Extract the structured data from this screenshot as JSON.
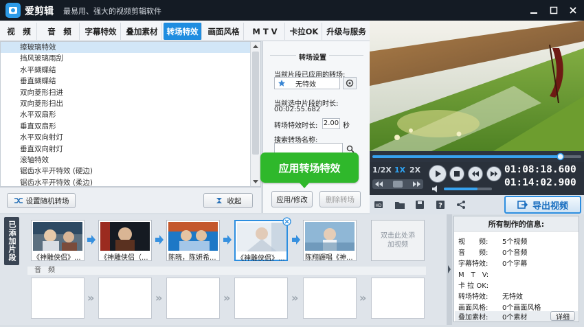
{
  "app": {
    "name": "爱剪辑",
    "slogan": "最易用、强大的视频剪辑软件"
  },
  "tabs": [
    "视　频",
    "音　频",
    "字幕特效",
    "叠加素材",
    "转场特效",
    "画面风格",
    "M T V",
    "卡拉OK",
    "升级与服务"
  ],
  "active_tab": "转场特效",
  "transitions": [
    "擦玻璃特效",
    "挡风玻璃雨刮",
    "水平蝴蝶结",
    "垂直蝴蝶结",
    "双向菱形扫进",
    "双向菱形扫出",
    "水平双扇形",
    "垂直双扇形",
    "水平双向射灯",
    "垂直双向射灯",
    "滚轴特效",
    "锯齿水平开特效 (硬边)",
    "锯齿水平开特效 (柔边)"
  ],
  "selected_transition": "擦玻璃特效",
  "left_bottom": {
    "random_button": "设置随机转场",
    "collapse_button": "收起"
  },
  "settings": {
    "section_title": "转场设置",
    "applied_label": "当前片段已应用的转场:",
    "applied_value": "无特效",
    "duration_label": "当前选中片段的时长:",
    "duration_value": "00:02:55.682",
    "effect_duration_label": "转场特效时长:",
    "effect_duration_value": "2.00",
    "effect_duration_unit": "秒",
    "search_label": "搜索转场名称:",
    "apply_button": "应用/修改",
    "delete_button": "删除转场"
  },
  "callout_text": "应用转场特效",
  "player": {
    "speed_half": "1/2X",
    "speed_1x": "1X",
    "speed_2x": "2X",
    "time_current": "01:08:18.600",
    "time_total": "01:14:02.900",
    "progress": 0.9,
    "volume": 0.7,
    "export_button": "导出视频"
  },
  "added_panel": {
    "label": "已添加片段",
    "clips": [
      "《神雕侠侣》...",
      "《神雕侠侣（...",
      "陈晓，陈妍希...",
      "《神雕侠侣》...",
      "陈翔鼲唱《神..."
    ],
    "add_hint": "双击此处添加视频",
    "audio_label": "音　频"
  },
  "info_panel": {
    "title": "所有制作的信息:",
    "rows": [
      {
        "key": "视　　频:",
        "value": "5个视频"
      },
      {
        "key": "音　　频:",
        "value": "0个音频"
      },
      {
        "key": "字幕特效:",
        "value": "0个字幕"
      },
      {
        "key": "M　T　V:",
        "value": ""
      },
      {
        "key": "卡 拉 OK:",
        "value": ""
      },
      {
        "key": "转场特效:",
        "value": "无特效"
      },
      {
        "key": "画面风格:",
        "value": "0个画面风格"
      },
      {
        "key": "叠加素材:",
        "value": "0个素材"
      }
    ],
    "detail_button": "详细"
  },
  "colors": {
    "accent": "#1f8de0",
    "callout": "#2fb82b",
    "titlebar": "#141b24"
  }
}
